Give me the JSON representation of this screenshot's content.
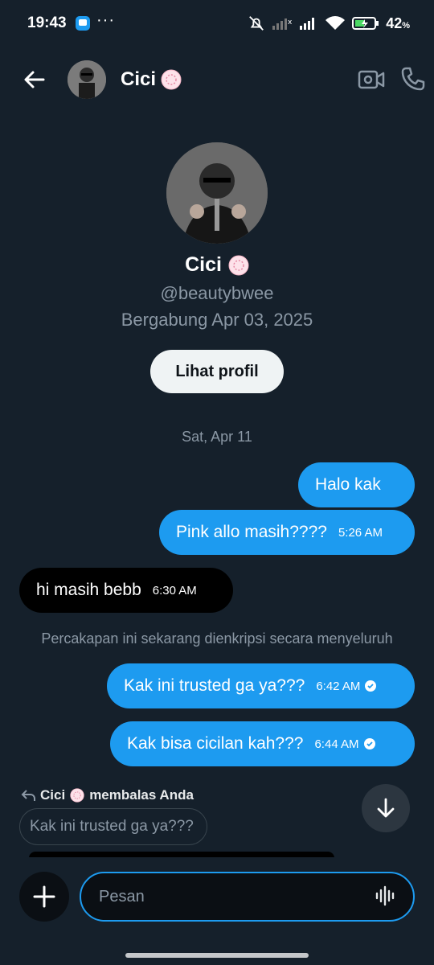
{
  "status_bar": {
    "time": "19:43",
    "battery": "42",
    "battery_unit": "%",
    "icons": [
      "chat-app-icon",
      "more-dots-icon",
      "mute-icon",
      "signal-icon",
      "signal-icon",
      "wifi-icon",
      "battery-icon"
    ]
  },
  "header": {
    "name": "Cici",
    "icons": [
      "back-arrow-icon",
      "video-call-icon",
      "phone-icon"
    ]
  },
  "profile": {
    "name": "Cici",
    "handle": "@beautybwee",
    "joined": "Bergabung Apr 03, 2025",
    "view_profile_label": "Lihat profil"
  },
  "conversation": {
    "date_label": "Sat, Apr 11",
    "messages": [
      {
        "direction": "out",
        "text": "Halo kak",
        "time": ""
      },
      {
        "direction": "out",
        "text": "Pink allo masih????",
        "time": "5:26 AM"
      },
      {
        "direction": "in",
        "text": "hi masih bebb",
        "time": "6:30 AM"
      },
      {
        "direction": "out",
        "text": "Kak ini trusted ga ya???",
        "time": "6:42 AM",
        "read": true
      },
      {
        "direction": "out",
        "text": "Kak bisa cicilan kah???",
        "time": "6:44 AM",
        "read": true
      }
    ],
    "system_message": "Percakapan ini sekarang dienkripsi secara menyeluruh",
    "reply": {
      "author": "Cici",
      "action": "membalas Anda",
      "quoted": "Kak ini trusted ga ya???"
    }
  },
  "composer": {
    "placeholder": "Pesan"
  },
  "colors": {
    "background": "#15202b",
    "accent": "#1d9bf0",
    "incoming_bubble": "#000000",
    "muted_text": "#8b98a5"
  }
}
